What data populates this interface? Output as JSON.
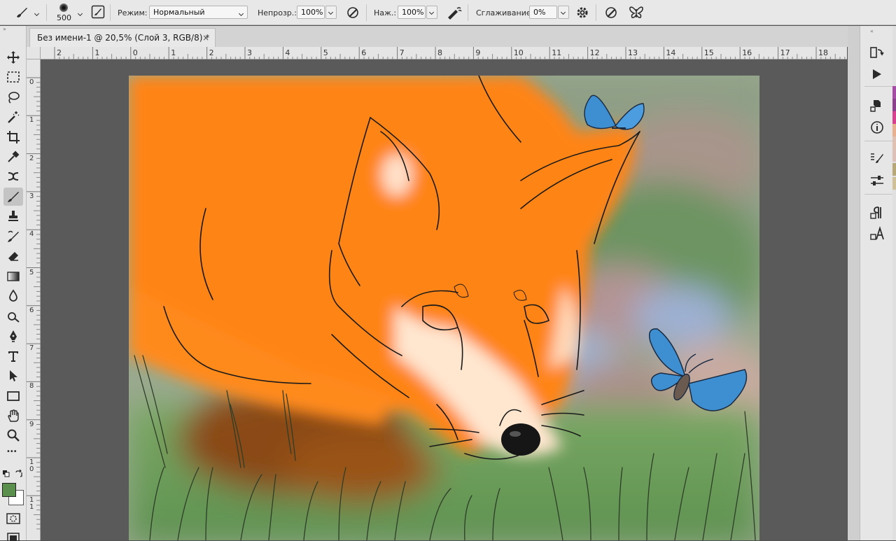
{
  "options": {
    "brush_size": "500",
    "mode_label": "Режим:",
    "mode_value": "Нормальный",
    "opacity_label": "Непрозр.:",
    "opacity_value": "100%",
    "pressure_label": "Наж.:",
    "pressure_value": "100%",
    "smoothing_label": "Сглаживание:",
    "smoothing_value": "0%"
  },
  "document": {
    "tab_title": "Без имени-1 @ 20,5% (Слой 3, RGB/8) *",
    "close_glyph": "×"
  },
  "ruler_top": [
    "2",
    "1",
    "0",
    "1",
    "2",
    "3",
    "4",
    "5",
    "6",
    "7",
    "8",
    "9",
    "10",
    "11",
    "12",
    "13",
    "14",
    "15",
    "16",
    "17",
    "18"
  ],
  "ruler_left": [
    "0",
    "1",
    "2",
    "3",
    "4",
    "5",
    "6",
    "7",
    "8",
    "9",
    "1 0",
    "1 1"
  ],
  "toolbar": {
    "more_glyph": "•••",
    "foreground_color": "#5a8f4e",
    "background_color": "#ffffff",
    "tools": [
      "move-tool",
      "marquee-tool",
      "lasso-tool",
      "magic-wand-tool",
      "crop-tool",
      "eyedropper-tool",
      "healing-tool",
      "brush-tool",
      "stamp-tool",
      "history-brush-tool",
      "eraser-tool",
      "gradient-tool",
      "blur-tool",
      "dodge-tool",
      "pen-tool",
      "type-tool",
      "path-select-tool",
      "rectangle-tool",
      "hand-tool",
      "zoom-tool"
    ]
  },
  "right_panel": {
    "icons": [
      "history-icon",
      "actions-play-icon",
      "3d-icon",
      "info-icon",
      "brush-settings-icon",
      "adjustments-icon",
      "paragraph-icon",
      "character-icon"
    ],
    "swatches": [
      "#a64ca6",
      "#8e3f8e",
      "#d9408f",
      "#e8b08e",
      "#e0c0b0",
      "#ddc0b8",
      "#b8a878",
      "#d0c098"
    ]
  },
  "artwork": {
    "description_colors": {
      "fox": "#ff8412",
      "grass": "#6c9f5a",
      "butterfly": "#3d8fd1"
    }
  }
}
